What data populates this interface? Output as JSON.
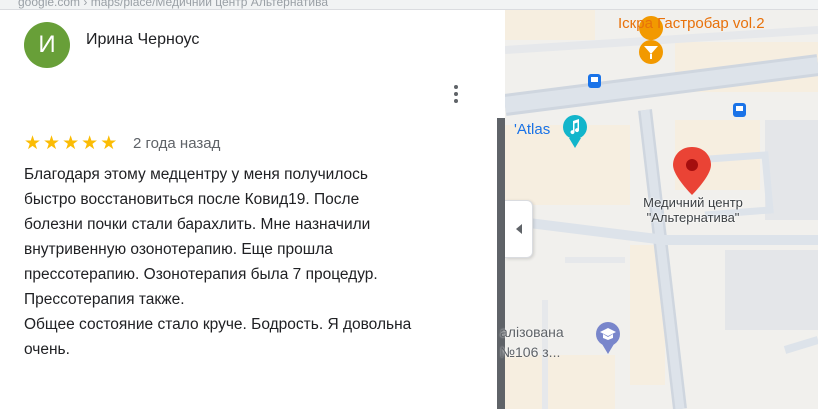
{
  "browser": {
    "url_fragment": "google.com › maps/place/Медичний центр Альтернатива"
  },
  "review": {
    "author_initial": "И",
    "author_name": "Ирина Черноус",
    "avatar_color": "#689f38",
    "rating": 5,
    "rating_max": 5,
    "date": "2 года назад",
    "text_lines": [
      "Благодаря этому медцентру у меня получилось",
      "быстро восстановиться после Ковид19. После",
      "болезни почки стали барахлить. Мне назначили",
      "внутривенную озонотерапию. Еще прошла",
      "прессотерапию. Озонотерапия была 7 процедур.",
      "Прессотерапия также.",
      "Общее состояние стало круче. Бодрость. Я довольна",
      "очень."
    ],
    "menu_icon": "more-vert-icon"
  },
  "map": {
    "places": {
      "bar": "Іскра Гастробар vol.2",
      "atlas": "'Atlas",
      "clinic_line1": "Медичний центр",
      "clinic_line2": "\"Альтернатива\"",
      "school_line1": "алізована",
      "school_line2": "№106 з..."
    },
    "colors": {
      "pin": "#ea4335",
      "bar_icon": "#f29900",
      "atlas_icon": "#12b5cb",
      "school_icon": "#7986cb",
      "transit": "#1a73e8"
    },
    "collapse_icon": "chevron-left-icon"
  }
}
